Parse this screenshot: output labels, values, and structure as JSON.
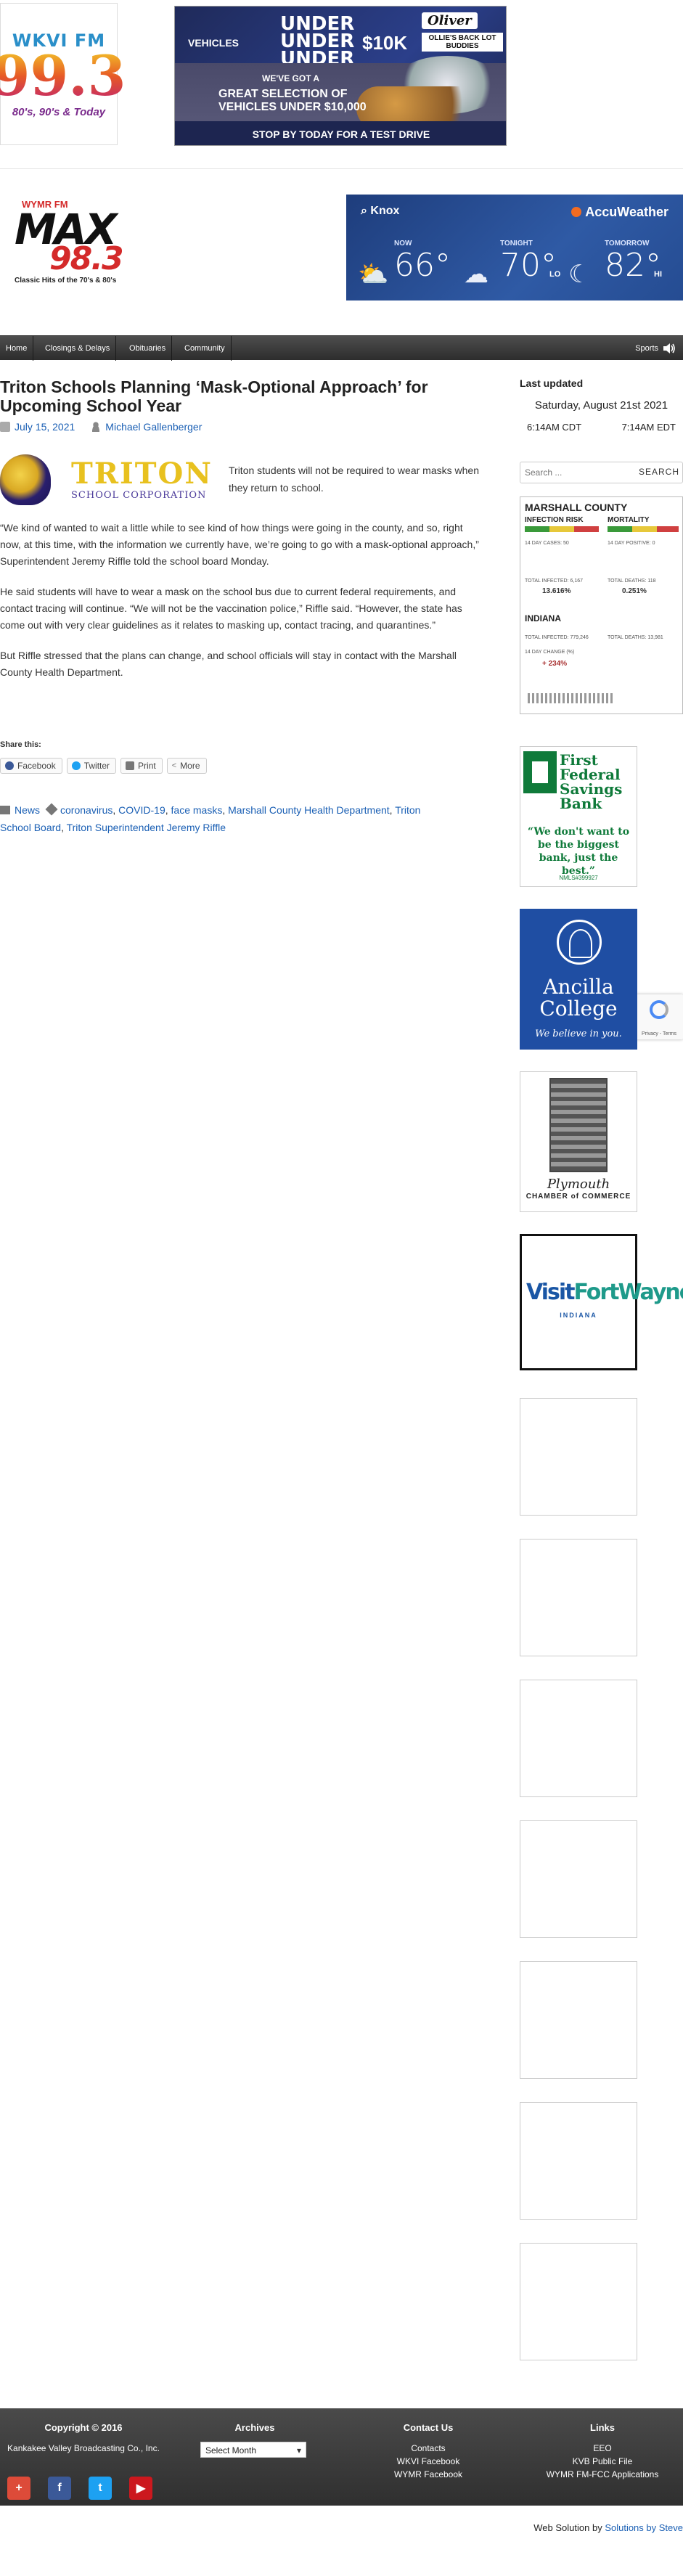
{
  "top_header": {
    "wkvi_logo": {
      "call": "WKVI FM",
      "freq": "99.3",
      "tag": "80's, 90's & Today"
    },
    "banner": {
      "vehicles": "VEHICLES",
      "under_lines": [
        "UNDER",
        "UNDER",
        "UNDER"
      ],
      "amount": "$10K",
      "brand": "Oliver",
      "brand_sub": "OLLIE'S BACK LOT BUDDIES",
      "got": "WE'VE GOT A",
      "great_line1": "GREAT SELECTION OF",
      "great_line2": "VEHICLES UNDER $10,000",
      "cta": "STOP BY TODAY FOR A TEST DRIVE"
    }
  },
  "max_logo": {
    "station": "WYMR FM",
    "word": "MAX",
    "num": "98.3",
    "tag": "Classic Hits of the 70's & 80's"
  },
  "weather": {
    "location": "Knox",
    "brand": "AccuWeather",
    "columns": [
      {
        "label": "NOW",
        "temp": "66°",
        "sub": "",
        "icon": "partly-cloudy-night-icon",
        "glyph": "⛅"
      },
      {
        "label": "TONIGHT",
        "temp": "70°",
        "sub": "LO",
        "icon": "moon-cloud-icon",
        "glyph": "☁"
      },
      {
        "label": "TOMORROW",
        "temp": "82°",
        "sub": "HI",
        "icon": "moon-icon",
        "glyph": "☾"
      }
    ]
  },
  "nav": {
    "items": [
      "Home",
      "Closings & Delays",
      "Obituaries",
      "Community"
    ],
    "right": "Sports"
  },
  "article": {
    "title": "Triton Schools Planning ‘Mask-Optional Approach’ for Upcoming School Year",
    "date": "July 15, 2021",
    "author": "Michael Gallenberger",
    "logo": {
      "word": "TRITON",
      "sub": "SCHOOL CORPORATION"
    },
    "lead": "Triton students will not be required to wear masks when they return to school.",
    "paragraphs": [
      "“We kind of wanted to wait a little while to see kind of how things were going in the county, and so, right now, at this time, with the information we currently have, we’re going to go with a mask-optional approach,” Superintendent Jeremy Riffle told the school board Monday.",
      "He said students will have to wear a mask on the school bus due to current federal requirements, and contact tracing will continue. “We will not be the vaccination police,” Riffle said. “However, the state has come out with very clear guidelines as it relates to masking up, contact tracing, and quarantines.”",
      "But Riffle stressed that the plans can change, and school officials will stay in contact with the Marshall County Health Department."
    ],
    "share_title": "Share this:",
    "share_buttons": [
      {
        "label": "Facebook",
        "color": "#3b5998"
      },
      {
        "label": "Twitter",
        "color": "#1da1f2"
      },
      {
        "label": "Print",
        "color": "#777777"
      },
      {
        "label": "More",
        "color": "#777777"
      }
    ],
    "category": "News",
    "tags_line1": [
      "coronavirus",
      "COVID-19",
      "face masks",
      "Marshall County Health Department",
      "Triton"
    ],
    "tags_line2": [
      "School Board",
      "Triton Superintendent Jeremy Riffle"
    ]
  },
  "sidebar": {
    "last_updated_title": "Last updated",
    "date": "Saturday, August 21st 2021",
    "time_cdt": "6:14AM CDT",
    "time_edt": "7:14AM EDT",
    "search_placeholder": "Search ...",
    "search_button": "SEARCH",
    "covid": {
      "county": "MARSHALL COUNTY",
      "risk_label": "INFECTION RISK",
      "mortality_label": "MORTALITY",
      "state": "INDIANA",
      "rows_county": [
        "14 DAY CASES: 50",
        "14 DAY POSITIVE: 0",
        "TOTAL INFECTED: 6,167",
        "TOTAL DEATHS: 118"
      ],
      "county_pct1": "13.616%",
      "county_pct2": "0.251%",
      "rows_state": [
        "TOTAL INFECTED: 779,246",
        "TOTAL DEATHS: 13,981",
        "14 DAY CHANGE (%)"
      ],
      "state_pct": "+ 234%"
    },
    "recaptcha_text": "Privacy - Terms",
    "ffsb": {
      "name_line1": "First",
      "name_line2": "Federal",
      "name_line3": "Savings",
      "name_line4": "Bank",
      "quote": "“We don't want to be the biggest bank, just the best.”",
      "fdic": "NMLS#399927"
    },
    "ancilla": {
      "name_line1": "Ancilla",
      "name_line2": "College",
      "tag": "We believe in you."
    },
    "plymouth": {
      "name": "Plymouth",
      "sub": "CHAMBER of COMMERCE"
    },
    "fortwayne": {
      "visit": "Visit",
      "city": "FortWayne",
      "state": "INDIANA"
    }
  },
  "footer": {
    "copyright_title": "Copyright © 2016",
    "copyright_text": "Kankakee Valley Broadcasting Co., Inc.",
    "archives_title": "Archives",
    "archives_select": "Select Month",
    "contact_title": "Contact Us",
    "contact_links": [
      "Contacts",
      "WKVI Facebook",
      "WYMR Facebook"
    ],
    "links_title": "Links",
    "links": [
      "EEO",
      "KVB Public File",
      "WYMR FM-FCC Applications"
    ],
    "social": [
      {
        "name": "google-plus-icon",
        "glyph": "+",
        "color": "#dd4b39"
      },
      {
        "name": "facebook-icon",
        "glyph": "f",
        "color": "#3b5998"
      },
      {
        "name": "twitter-icon",
        "glyph": "t",
        "color": "#1da1f2"
      },
      {
        "name": "youtube-icon",
        "glyph": "▶",
        "color": "#cc181e"
      }
    ]
  },
  "credit": {
    "prefix": "Web Solution by ",
    "link": "Solutions by Steve"
  }
}
